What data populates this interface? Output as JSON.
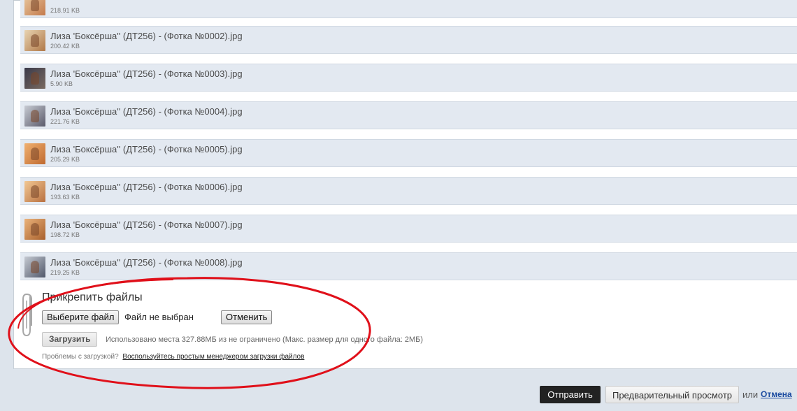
{
  "files": [
    {
      "name": "",
      "size": "218.91 KB",
      "thumb": [
        "#e9c9a0",
        "#c47a4c"
      ]
    },
    {
      "name": "Лиза 'Боксёрша'' (ДТ256) - (Фотка №0002).jpg",
      "size": "200.42 KB",
      "thumb": [
        "#e8d4b2",
        "#b07848"
      ]
    },
    {
      "name": "Лиза 'Боксёрша'' (ДТ256) - (Фотка №0003).jpg",
      "size": "5.90 KB",
      "thumb": [
        "#3a3a4a",
        "#7a6a60"
      ]
    },
    {
      "name": "Лиза 'Боксёрша'' (ДТ256) - (Фотка №0004).jpg",
      "size": "221.76 KB",
      "thumb": [
        "#c8ccd4",
        "#5a5a6a"
      ]
    },
    {
      "name": "Лиза 'Боксёрша'' (ДТ256) - (Фотка №0005).jpg",
      "size": "205.29 KB",
      "thumb": [
        "#f0b070",
        "#c06a30"
      ]
    },
    {
      "name": "Лиза 'Боксёрша'' (ДТ256) - (Фотка №0006).jpg",
      "size": "193.63 KB",
      "thumb": [
        "#f2c894",
        "#b87040"
      ]
    },
    {
      "name": "Лиза 'Боксёрша'' (ДТ256) - (Фотка №0007).jpg",
      "size": "198.72 KB",
      "thumb": [
        "#eab27a",
        "#a8602c"
      ]
    },
    {
      "name": "Лиза 'Боксёрша'' (ДТ256) - (Фотка №0008).jpg",
      "size": "219.25 KB",
      "thumb": [
        "#c6cad2",
        "#50586a"
      ]
    }
  ],
  "attach": {
    "title": "Прикрепить файлы",
    "choose_label": "Выберите файл",
    "no_file": "Файл не выбран",
    "cancel_label": "Отменить",
    "upload_label": "Загрузить",
    "usage": "Использовано места 327.88МБ из не ограничено (Макс. размер для одного файла: 2МБ)",
    "problems_text": "Проблемы с загрузкой?",
    "problems_link": "Воспользуйтесь простым менеджером загрузки файлов"
  },
  "footer": {
    "send_label": "Отправить",
    "preview_label": "Предварительный просмотр",
    "or_text": "или",
    "cancel_label": "Отмена"
  },
  "colors": {
    "annotation": "#e0101a",
    "row_bg": "#e3e9f1",
    "send_bg": "#222222"
  }
}
